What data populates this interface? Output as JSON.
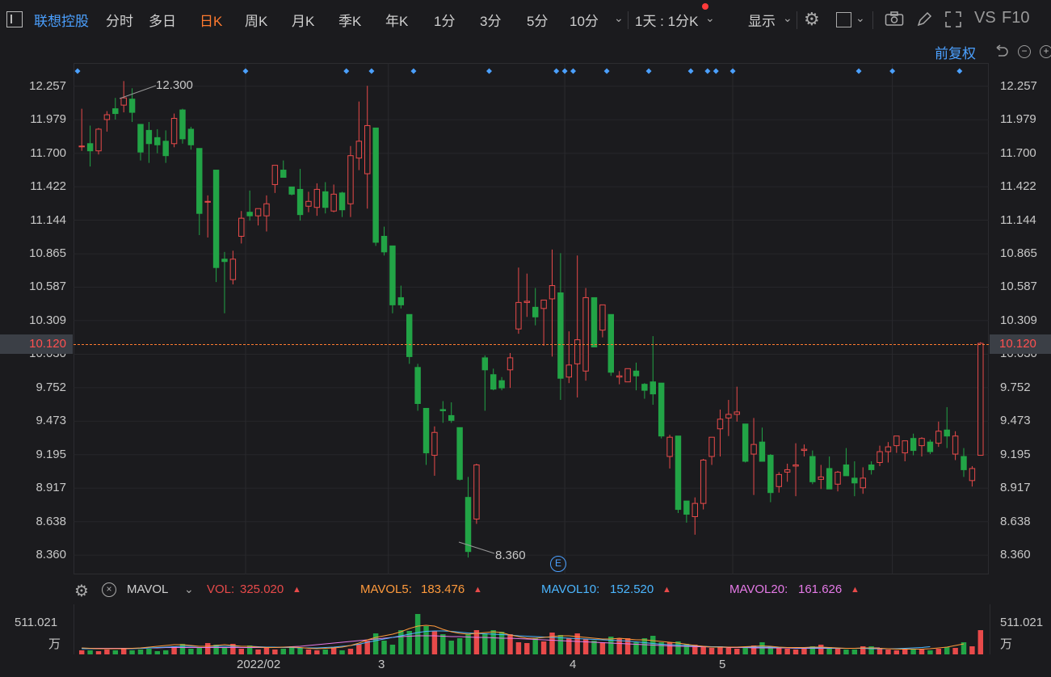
{
  "toolbar": {
    "stock_name": "联想控股",
    "periods": [
      "分时",
      "多日",
      "日K",
      "周K",
      "月K",
      "季K",
      "年K",
      "1分",
      "3分",
      "5分",
      "10分"
    ],
    "active_period": "日K",
    "interval_select": "1天 : 1分K",
    "display_label": "显示",
    "vs_label": "VS",
    "f10_label": "F10"
  },
  "chart_header": {
    "adjust_label": "前复权"
  },
  "price_axis": {
    "ticks": [
      "12.257",
      "11.979",
      "11.700",
      "11.422",
      "11.144",
      "10.865",
      "10.587",
      "10.309",
      "10.030",
      "9.752",
      "9.473",
      "9.195",
      "8.917",
      "8.638",
      "8.360"
    ],
    "current_price": "10.120"
  },
  "annotations": {
    "high_label": "12.300",
    "low_label": "8.360",
    "event_marker": "E"
  },
  "indicator_bar": {
    "name": "MAVOL",
    "vol_label": "VOL:",
    "vol_value": "325.020",
    "mavol5_label": "MAVOL5:",
    "mavol5_value": "183.476",
    "mavol10_label": "MAVOL10:",
    "mavol10_value": "152.520",
    "mavol20_label": "MAVOL20:",
    "mavol20_value": "161.626"
  },
  "volume_axis": {
    "max_label": "511.021",
    "unit_label": "万"
  },
  "x_axis": {
    "labels": [
      "2022/02",
      "3",
      "4",
      "5"
    ]
  },
  "colors": {
    "up": "#e84a4a",
    "down": "#22a446",
    "accent": "#ff7a2f",
    "blue": "#4ba0ff",
    "mavol5": "#ff9a3c",
    "mavol10": "#4bb6ff",
    "mavol20": "#e67ae8"
  },
  "chart_data": {
    "type": "candlestick",
    "ylim": [
      8.2,
      12.45
    ],
    "series": [
      {
        "o": 11.76,
        "h": 12.07,
        "l": 11.72,
        "c": 11.76
      },
      {
        "o": 11.78,
        "h": 11.93,
        "l": 11.59,
        "c": 11.72
      },
      {
        "o": 11.72,
        "h": 11.91,
        "l": 11.69,
        "c": 11.9
      },
      {
        "o": 11.98,
        "h": 12.05,
        "l": 11.88,
        "c": 12.02
      },
      {
        "o": 12.07,
        "h": 12.16,
        "l": 11.98,
        "c": 12.03
      },
      {
        "o": 12.1,
        "h": 12.3,
        "l": 12.04,
        "c": 12.16
      },
      {
        "o": 12.15,
        "h": 12.24,
        "l": 11.96,
        "c": 12.04
      },
      {
        "o": 11.94,
        "h": 11.94,
        "l": 11.64,
        "c": 11.71
      },
      {
        "o": 11.89,
        "h": 11.96,
        "l": 11.62,
        "c": 11.78
      },
      {
        "o": 11.83,
        "h": 11.9,
        "l": 11.7,
        "c": 11.77
      },
      {
        "o": 11.8,
        "h": 11.89,
        "l": 11.62,
        "c": 11.68
      },
      {
        "o": 11.78,
        "h": 12.03,
        "l": 11.75,
        "c": 11.99
      },
      {
        "o": 12.06,
        "h": 12.07,
        "l": 11.78,
        "c": 11.82
      },
      {
        "o": 11.9,
        "h": 11.92,
        "l": 11.73,
        "c": 11.77
      },
      {
        "o": 11.74,
        "h": 11.74,
        "l": 11.02,
        "c": 11.2
      },
      {
        "o": 11.3,
        "h": 11.35,
        "l": 11.0,
        "c": 11.3
      },
      {
        "o": 11.56,
        "h": 11.56,
        "l": 10.63,
        "c": 10.75
      },
      {
        "o": 10.82,
        "h": 10.88,
        "l": 10.37,
        "c": 10.8
      },
      {
        "o": 10.65,
        "h": 10.89,
        "l": 10.61,
        "c": 10.82
      },
      {
        "o": 11.01,
        "h": 11.22,
        "l": 10.95,
        "c": 11.16
      },
      {
        "o": 11.21,
        "h": 11.39,
        "l": 11.14,
        "c": 11.18
      },
      {
        "o": 11.18,
        "h": 11.24,
        "l": 11.1,
        "c": 11.24
      },
      {
        "o": 11.18,
        "h": 11.35,
        "l": 11.05,
        "c": 11.28
      },
      {
        "o": 11.44,
        "h": 11.59,
        "l": 11.37,
        "c": 11.6
      },
      {
        "o": 11.56,
        "h": 11.64,
        "l": 11.5,
        "c": 11.5
      },
      {
        "o": 11.42,
        "h": 11.42,
        "l": 11.35,
        "c": 11.36
      },
      {
        "o": 11.4,
        "h": 11.57,
        "l": 11.14,
        "c": 11.19
      },
      {
        "o": 11.26,
        "h": 11.38,
        "l": 11.21,
        "c": 11.3
      },
      {
        "o": 11.25,
        "h": 11.45,
        "l": 11.18,
        "c": 11.4
      },
      {
        "o": 11.38,
        "h": 11.46,
        "l": 11.2,
        "c": 11.25
      },
      {
        "o": 11.22,
        "h": 11.44,
        "l": 11.21,
        "c": 11.36
      },
      {
        "o": 11.37,
        "h": 11.38,
        "l": 11.17,
        "c": 11.23
      },
      {
        "o": 11.28,
        "h": 11.76,
        "l": 11.17,
        "c": 11.68
      },
      {
        "o": 11.66,
        "h": 12.13,
        "l": 11.56,
        "c": 11.8
      },
      {
        "o": 11.53,
        "h": 12.26,
        "l": 11.24,
        "c": 11.93
      },
      {
        "o": 11.91,
        "h": 11.91,
        "l": 10.93,
        "c": 10.96
      },
      {
        "o": 11.01,
        "h": 11.09,
        "l": 10.85,
        "c": 10.88
      },
      {
        "o": 10.93,
        "h": 10.93,
        "l": 10.37,
        "c": 10.44
      },
      {
        "o": 10.5,
        "h": 10.6,
        "l": 10.41,
        "c": 10.44
      },
      {
        "o": 10.36,
        "h": 10.36,
        "l": 9.95,
        "c": 10.01
      },
      {
        "o": 9.92,
        "h": 9.95,
        "l": 9.56,
        "c": 9.62
      },
      {
        "o": 9.58,
        "h": 9.58,
        "l": 9.11,
        "c": 9.21
      },
      {
        "o": 9.19,
        "h": 9.43,
        "l": 9.02,
        "c": 9.38
      },
      {
        "o": 9.57,
        "h": 9.64,
        "l": 9.46,
        "c": 9.56
      },
      {
        "o": 9.52,
        "h": 9.63,
        "l": 9.46,
        "c": 9.48
      },
      {
        "o": 9.42,
        "h": 9.42,
        "l": 8.98,
        "c": 8.99
      },
      {
        "o": 8.84,
        "h": 9.01,
        "l": 8.34,
        "c": 8.39
      },
      {
        "o": 8.66,
        "h": 9.12,
        "l": 8.62,
        "c": 9.11
      },
      {
        "o": 10.0,
        "h": 10.02,
        "l": 9.56,
        "c": 9.9
      },
      {
        "o": 9.86,
        "h": 9.91,
        "l": 9.73,
        "c": 9.74
      },
      {
        "o": 9.81,
        "h": 9.84,
        "l": 9.73,
        "c": 9.75
      },
      {
        "o": 9.9,
        "h": 10.04,
        "l": 9.75,
        "c": 10.0
      },
      {
        "o": 10.24,
        "h": 10.75,
        "l": 10.2,
        "c": 10.46
      },
      {
        "o": 10.46,
        "h": 10.7,
        "l": 10.34,
        "c": 10.47
      },
      {
        "o": 10.42,
        "h": 10.58,
        "l": 10.27,
        "c": 10.34
      },
      {
        "o": 10.41,
        "h": 10.48,
        "l": 10.1,
        "c": 10.48
      },
      {
        "o": 10.49,
        "h": 10.9,
        "l": 10.01,
        "c": 10.6
      },
      {
        "o": 10.54,
        "h": 10.87,
        "l": 9.65,
        "c": 9.83
      },
      {
        "o": 9.84,
        "h": 10.22,
        "l": 9.79,
        "c": 9.94
      },
      {
        "o": 9.95,
        "h": 10.85,
        "l": 9.67,
        "c": 10.15
      },
      {
        "o": 9.89,
        "h": 10.58,
        "l": 9.81,
        "c": 10.5
      },
      {
        "o": 10.5,
        "h": 10.5,
        "l": 10.1,
        "c": 10.09
      },
      {
        "o": 10.23,
        "h": 10.44,
        "l": 10.17,
        "c": 10.44
      },
      {
        "o": 10.36,
        "h": 10.36,
        "l": 9.85,
        "c": 9.88
      },
      {
        "o": 9.84,
        "h": 9.89,
        "l": 9.78,
        "c": 9.85
      },
      {
        "o": 9.8,
        "h": 9.91,
        "l": 9.8,
        "c": 9.91
      },
      {
        "o": 9.89,
        "h": 9.96,
        "l": 9.73,
        "c": 9.85
      },
      {
        "o": 9.78,
        "h": 9.79,
        "l": 9.66,
        "c": 9.73
      },
      {
        "o": 9.8,
        "h": 10.18,
        "l": 9.61,
        "c": 9.7
      },
      {
        "o": 9.79,
        "h": 9.79,
        "l": 9.33,
        "c": 9.35
      },
      {
        "o": 9.18,
        "h": 9.36,
        "l": 9.08,
        "c": 9.34
      },
      {
        "o": 9.35,
        "h": 9.35,
        "l": 8.71,
        "c": 8.74
      },
      {
        "o": 8.81,
        "h": 8.81,
        "l": 8.63,
        "c": 8.7
      },
      {
        "o": 8.68,
        "h": 8.84,
        "l": 8.53,
        "c": 8.79
      },
      {
        "o": 8.79,
        "h": 9.16,
        "l": 8.74,
        "c": 9.15
      },
      {
        "o": 9.18,
        "h": 9.34,
        "l": 9.11,
        "c": 9.34
      },
      {
        "o": 9.41,
        "h": 9.57,
        "l": 9.18,
        "c": 9.49
      },
      {
        "o": 9.5,
        "h": 9.65,
        "l": 9.35,
        "c": 9.53
      },
      {
        "o": 9.53,
        "h": 9.76,
        "l": 9.47,
        "c": 9.55
      },
      {
        "o": 9.45,
        "h": 9.45,
        "l": 9.13,
        "c": 9.14
      },
      {
        "o": 9.2,
        "h": 9.5,
        "l": 8.86,
        "c": 9.28
      },
      {
        "o": 9.3,
        "h": 9.42,
        "l": 9.16,
        "c": 9.14
      },
      {
        "o": 9.19,
        "h": 9.2,
        "l": 8.8,
        "c": 8.88
      },
      {
        "o": 8.93,
        "h": 9.05,
        "l": 8.88,
        "c": 9.03
      },
      {
        "o": 9.05,
        "h": 9.12,
        "l": 8.97,
        "c": 9.07
      },
      {
        "o": 9.1,
        "h": 9.29,
        "l": 8.85,
        "c": 9.11
      },
      {
        "o": 9.23,
        "h": 9.28,
        "l": 9.18,
        "c": 9.24
      },
      {
        "o": 9.18,
        "h": 9.23,
        "l": 8.95,
        "c": 8.97
      },
      {
        "o": 8.99,
        "h": 9.11,
        "l": 8.91,
        "c": 9.01
      },
      {
        "o": 9.08,
        "h": 9.18,
        "l": 8.93,
        "c": 8.91
      },
      {
        "o": 8.95,
        "h": 9.06,
        "l": 8.89,
        "c": 9.05
      },
      {
        "o": 9.11,
        "h": 9.25,
        "l": 9.09,
        "c": 9.02
      },
      {
        "o": 9.0,
        "h": 9.14,
        "l": 8.85,
        "c": 8.96
      },
      {
        "o": 8.92,
        "h": 9.09,
        "l": 8.87,
        "c": 9.0
      },
      {
        "o": 9.11,
        "h": 9.14,
        "l": 9.03,
        "c": 9.07
      },
      {
        "o": 9.13,
        "h": 9.27,
        "l": 9.1,
        "c": 9.22
      },
      {
        "o": 9.22,
        "h": 9.3,
        "l": 9.13,
        "c": 9.26
      },
      {
        "o": 9.27,
        "h": 9.34,
        "l": 9.21,
        "c": 9.35
      },
      {
        "o": 9.21,
        "h": 9.3,
        "l": 9.14,
        "c": 9.31
      },
      {
        "o": 9.33,
        "h": 9.37,
        "l": 9.19,
        "c": 9.23
      },
      {
        "o": 9.27,
        "h": 9.34,
        "l": 9.18,
        "c": 9.33
      },
      {
        "o": 9.3,
        "h": 9.32,
        "l": 9.2,
        "c": 9.22
      },
      {
        "o": 9.29,
        "h": 9.47,
        "l": 9.26,
        "c": 9.39
      },
      {
        "o": 9.4,
        "h": 9.59,
        "l": 9.25,
        "c": 9.35
      },
      {
        "o": 9.2,
        "h": 9.39,
        "l": 9.15,
        "c": 9.35
      },
      {
        "o": 9.18,
        "h": 9.25,
        "l": 9.01,
        "c": 9.07
      },
      {
        "o": 8.98,
        "h": 9.1,
        "l": 8.93,
        "c": 9.08
      },
      {
        "o": 9.19,
        "h": 10.13,
        "l": 9.19,
        "c": 10.12
      }
    ],
    "volumes": [
      0.1,
      0.1,
      0.08,
      0.12,
      0.1,
      0.14,
      0.1,
      0.12,
      0.14,
      0.08,
      0.1,
      0.2,
      0.26,
      0.14,
      0.18,
      0.28,
      0.24,
      0.16,
      0.26,
      0.14,
      0.22,
      0.12,
      0.18,
      0.12,
      0.14,
      0.2,
      0.16,
      0.12,
      0.1,
      0.12,
      0.18,
      0.1,
      0.14,
      0.26,
      0.34,
      0.52,
      0.34,
      0.24,
      0.6,
      0.58,
      1.0,
      0.7,
      0.58,
      0.5,
      0.34,
      0.4,
      0.5,
      0.6,
      0.52,
      0.6,
      0.56,
      0.5,
      0.3,
      0.28,
      0.4,
      0.32,
      0.54,
      0.48,
      0.4,
      0.52,
      0.38,
      0.34,
      0.3,
      0.44,
      0.4,
      0.4,
      0.3,
      0.4,
      0.46,
      0.3,
      0.3,
      0.32,
      0.26,
      0.24,
      0.2,
      0.16,
      0.2,
      0.16,
      0.14,
      0.18,
      0.22,
      0.3,
      0.2,
      0.18,
      0.14,
      0.12,
      0.16,
      0.2,
      0.24,
      0.18,
      0.16,
      0.12,
      0.12,
      0.2,
      0.2,
      0.16,
      0.12,
      0.1,
      0.14,
      0.12,
      0.12,
      0.1,
      0.14,
      0.18,
      0.16,
      0.3,
      0.2,
      0.6
    ],
    "ma5": [
      0.16,
      0.15,
      0.14,
      0.14,
      0.14,
      0.14,
      0.15,
      0.16,
      0.18,
      0.2,
      0.22,
      0.24,
      0.24,
      0.22,
      0.2,
      0.2,
      0.22,
      0.24,
      0.22,
      0.2,
      0.2,
      0.18,
      0.17,
      0.17,
      0.18,
      0.18,
      0.17,
      0.15,
      0.14,
      0.15,
      0.16,
      0.18,
      0.22,
      0.28,
      0.36,
      0.42,
      0.46,
      0.5,
      0.56,
      0.64,
      0.7,
      0.72,
      0.7,
      0.62,
      0.56,
      0.52,
      0.5,
      0.52,
      0.54,
      0.56,
      0.54,
      0.48,
      0.44,
      0.4,
      0.4,
      0.42,
      0.44,
      0.46,
      0.46,
      0.44,
      0.42,
      0.4,
      0.38,
      0.38,
      0.4,
      0.38,
      0.36,
      0.36,
      0.34,
      0.32,
      0.3,
      0.28,
      0.25,
      0.22,
      0.2,
      0.18,
      0.18,
      0.18,
      0.18,
      0.19,
      0.2,
      0.21,
      0.2,
      0.18,
      0.17,
      0.17,
      0.17,
      0.18,
      0.18,
      0.17,
      0.16,
      0.15,
      0.15,
      0.16,
      0.16,
      0.15,
      0.14,
      0.13,
      0.13,
      0.13,
      0.13,
      0.14,
      0.16,
      0.18,
      0.22,
      0.26
    ],
    "ma10": [
      0.14,
      0.14,
      0.14,
      0.14,
      0.14,
      0.14,
      0.14,
      0.15,
      0.16,
      0.17,
      0.18,
      0.19,
      0.2,
      0.2,
      0.2,
      0.2,
      0.2,
      0.2,
      0.2,
      0.2,
      0.2,
      0.19,
      0.18,
      0.18,
      0.17,
      0.17,
      0.16,
      0.16,
      0.16,
      0.17,
      0.18,
      0.2,
      0.22,
      0.25,
      0.3,
      0.34,
      0.38,
      0.42,
      0.46,
      0.5,
      0.54,
      0.57,
      0.58,
      0.58,
      0.57,
      0.55,
      0.53,
      0.52,
      0.51,
      0.5,
      0.49,
      0.48,
      0.46,
      0.45,
      0.44,
      0.43,
      0.42,
      0.41,
      0.4,
      0.39,
      0.38,
      0.37,
      0.36,
      0.35,
      0.34,
      0.33,
      0.31,
      0.29,
      0.27,
      0.25,
      0.24,
      0.23,
      0.22,
      0.21,
      0.2,
      0.19,
      0.19,
      0.18,
      0.18,
      0.18,
      0.18,
      0.18,
      0.18,
      0.17,
      0.17,
      0.16,
      0.16,
      0.16,
      0.16,
      0.16,
      0.15,
      0.15,
      0.15,
      0.15,
      0.14,
      0.14,
      0.14,
      0.14,
      0.15,
      0.16,
      0.17,
      0.19
    ],
    "ma20": [
      0.15,
      0.15,
      0.15,
      0.15,
      0.15,
      0.15,
      0.15,
      0.15,
      0.16,
      0.16,
      0.17,
      0.17,
      0.17,
      0.17,
      0.17,
      0.17,
      0.17,
      0.17,
      0.17,
      0.17,
      0.17,
      0.17,
      0.17,
      0.17,
      0.18,
      0.19,
      0.2,
      0.22,
      0.24,
      0.26,
      0.28,
      0.3,
      0.32,
      0.34,
      0.36,
      0.38,
      0.4,
      0.42,
      0.44,
      0.45,
      0.46,
      0.46,
      0.46,
      0.45,
      0.44,
      0.44,
      0.43,
      0.42,
      0.42,
      0.41,
      0.4,
      0.4,
      0.39,
      0.38,
      0.37,
      0.36,
      0.35,
      0.34,
      0.33,
      0.32,
      0.31,
      0.3,
      0.29,
      0.28,
      0.27,
      0.26,
      0.25,
      0.24,
      0.23,
      0.22,
      0.21,
      0.2,
      0.2,
      0.19,
      0.19,
      0.18,
      0.18,
      0.17,
      0.17,
      0.17,
      0.16,
      0.16,
      0.16,
      0.16,
      0.16,
      0.15,
      0.15,
      0.15,
      0.15,
      0.15,
      0.15,
      0.15,
      0.15,
      0.15,
      0.16,
      0.16
    ]
  }
}
